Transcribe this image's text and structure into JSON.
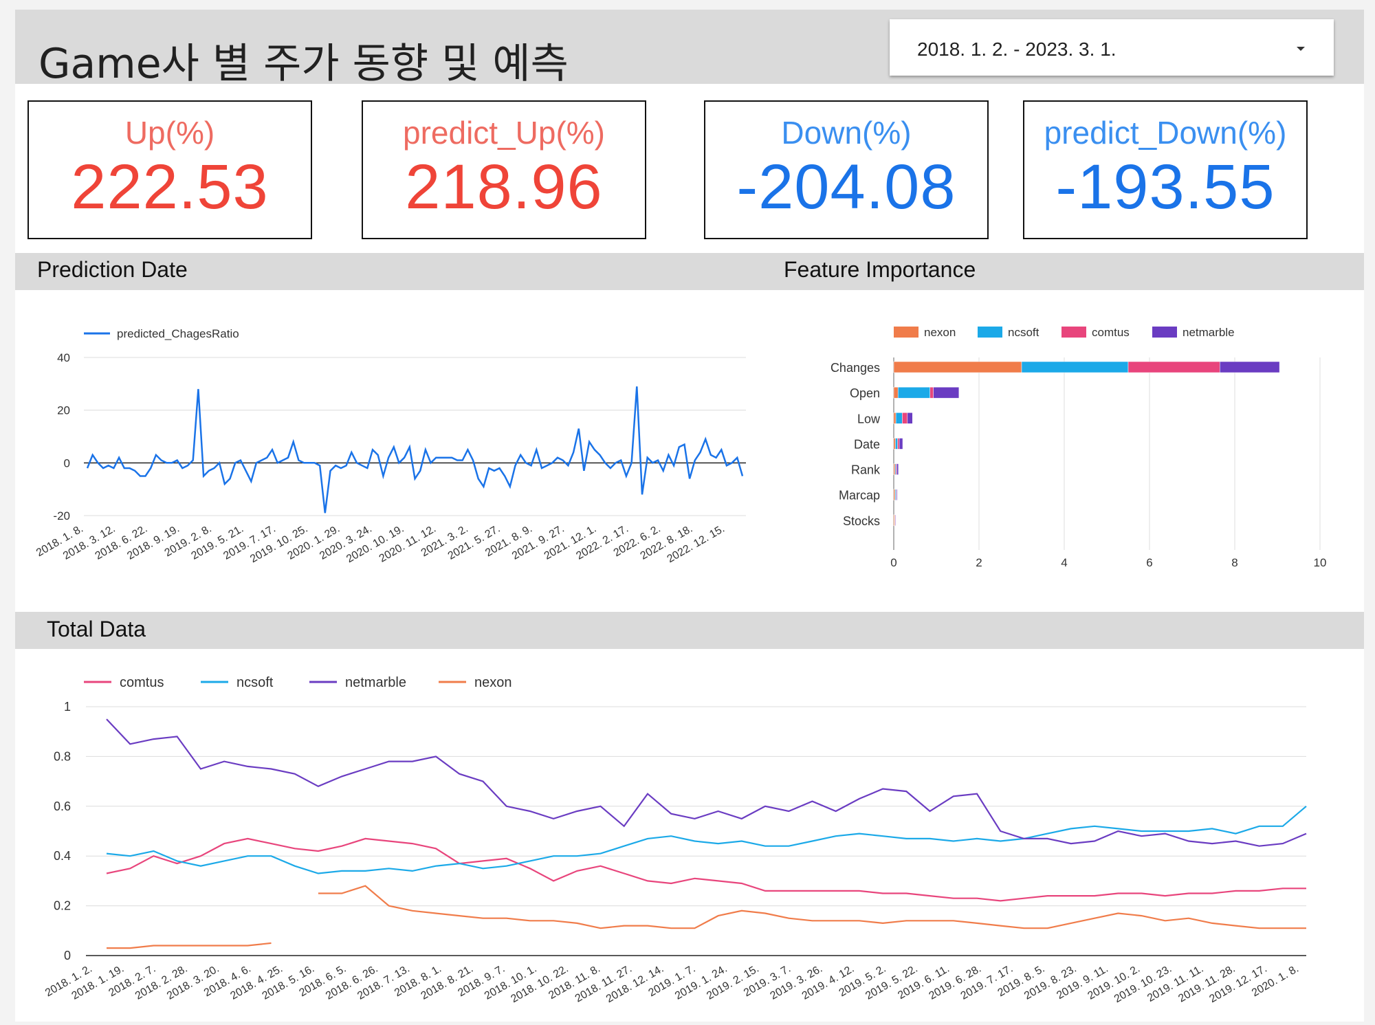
{
  "header": {
    "title": "Game사 별 주가 동향 및 예측",
    "date_range": "2018. 1. 2. - 2023. 3. 1."
  },
  "kpis": [
    {
      "label": "Up(%)",
      "value": "222.53"
    },
    {
      "label": "predict_Up(%)",
      "value": "218.96"
    },
    {
      "label": "Down(%)",
      "value": "-204.08"
    },
    {
      "label": "predict_Down(%)",
      "value": "-193.55"
    }
  ],
  "sections": {
    "prediction": "Prediction Date",
    "feature": "Feature Importance",
    "total": "Total Data"
  },
  "colors": {
    "nexon": "#f07c4a",
    "ncsoft": "#1ba9e8",
    "comtus": "#e8457c",
    "netmarble": "#6a3cc2",
    "predicted": "#1a73e8"
  },
  "chart_data": [
    {
      "type": "line",
      "title": "",
      "legend": [
        "predicted_ChagesRatio"
      ],
      "ylim": [
        -20,
        40
      ],
      "yticks": [
        "40",
        "20",
        "0",
        "-20"
      ],
      "x": [
        "2018. 1. 8.",
        "2018. 3. 12.",
        "2018. 6. 22.",
        "2018. 9. 19.",
        "2019. 2. 8.",
        "2019. 5. 21.",
        "2019. 7. 17.",
        "2019. 10. 25.",
        "2020. 1. 29.",
        "2020. 3. 24.",
        "2020. 10. 19.",
        "2020. 11. 12.",
        "2021. 3. 2.",
        "2021. 5. 27.",
        "2021. 8. 9.",
        "2021. 9. 27.",
        "2021. 12. 1.",
        "2022. 2. 17.",
        "2022. 6. 2.",
        "2022. 8. 18.",
        "2022. 12. 15."
      ],
      "series": [
        {
          "name": "predicted_ChagesRatio",
          "values": [
            -2,
            3,
            0,
            -2,
            -1,
            -2,
            2,
            -2,
            -2,
            -3,
            -5,
            -5,
            -2,
            3,
            1,
            0,
            0,
            1,
            -2,
            -1,
            1,
            28,
            -5,
            -3,
            -2,
            0,
            -8,
            -6,
            0,
            1,
            -3,
            -7,
            0,
            1,
            2,
            5,
            0,
            1,
            2,
            8,
            1,
            0,
            0,
            0,
            -1,
            -19,
            -3,
            -1,
            -2,
            -1,
            4,
            0,
            -1,
            -2,
            5,
            3,
            -5,
            2,
            6,
            0,
            2,
            6,
            -6,
            -3,
            5,
            0,
            2,
            2,
            2,
            2,
            1,
            1,
            5,
            1,
            -6,
            -9,
            -2,
            -3,
            -2,
            -5,
            -9,
            -1,
            3,
            0,
            -1,
            5,
            -2,
            -1,
            0,
            2,
            1,
            -1,
            4,
            13,
            -3,
            8,
            5,
            3,
            0,
            -2,
            0,
            1,
            -5,
            0,
            29,
            -12,
            2,
            0,
            1,
            -3,
            3,
            -1,
            6,
            7,
            -6,
            1,
            4,
            9,
            3,
            2,
            5,
            -1,
            0,
            2,
            -5
          ],
          "color": "#1a73e8"
        }
      ]
    },
    {
      "type": "bar",
      "orientation": "horizontal",
      "stacked": true,
      "title": "",
      "categories": [
        "Changes",
        "Open",
        "Low",
        "Date",
        "Rank",
        "Marcap",
        "Stocks"
      ],
      "xlim": [
        0,
        10
      ],
      "xticks": [
        "0",
        "2",
        "4",
        "6",
        "8",
        "10"
      ],
      "series": [
        {
          "name": "nexon",
          "values": [
            3.0,
            0.1,
            0.05,
            0.04,
            0.03,
            0.03,
            0.02
          ]
        },
        {
          "name": "ncsoft",
          "values": [
            2.5,
            0.75,
            0.15,
            0.05,
            0.02,
            0.02,
            0.01
          ]
        },
        {
          "name": "comtus",
          "values": [
            2.15,
            0.08,
            0.12,
            0.04,
            0.02,
            0.01,
            0.01
          ]
        },
        {
          "name": "netmarble",
          "values": [
            1.4,
            0.6,
            0.12,
            0.08,
            0.04,
            0.02,
            0.01
          ]
        }
      ]
    },
    {
      "type": "line",
      "title": "",
      "legend": [
        "comtus",
        "ncsoft",
        "netmarble",
        "nexon"
      ],
      "ylim": [
        0,
        1
      ],
      "yticks": [
        "1",
        "0.8",
        "0.6",
        "0.4",
        "0.2",
        "0"
      ],
      "x": [
        "2018. 1. 2.",
        "2018. 1. 19.",
        "2018. 2. 7.",
        "2018. 2. 28.",
        "2018. 3. 20.",
        "2018. 4. 6.",
        "2018. 4. 25.",
        "2018. 5. 16.",
        "2018. 6. 5.",
        "2018. 6. 26.",
        "2018. 7. 13.",
        "2018. 8. 1.",
        "2018. 8. 21.",
        "2018. 9. 7.",
        "2018. 10. 1.",
        "2018. 10. 22.",
        "2018. 11. 8.",
        "2018. 11. 27.",
        "2018. 12. 14.",
        "2019. 1. 7.",
        "2019. 1. 24.",
        "2019. 2. 15.",
        "2019. 3. 7.",
        "2019. 3. 26.",
        "2019. 4. 12.",
        "2019. 5. 2.",
        "2019. 5. 22.",
        "2019. 6. 11.",
        "2019. 6. 28.",
        "2019. 7. 17.",
        "2019. 8. 5.",
        "2019. 8. 23.",
        "2019. 9. 11.",
        "2019. 10. 2.",
        "2019. 10. 23.",
        "2019. 11. 11.",
        "2019. 11. 28.",
        "2019. 12. 17.",
        "2020. 1. 8."
      ],
      "series": [
        {
          "name": "comtus",
          "values": [
            0.33,
            0.35,
            0.4,
            0.37,
            0.4,
            0.45,
            0.47,
            0.45,
            0.43,
            0.42,
            0.44,
            0.47,
            0.46,
            0.45,
            0.43,
            0.37,
            0.38,
            0.39,
            0.35,
            0.3,
            0.34,
            0.36,
            0.33,
            0.3,
            0.29,
            0.31,
            0.3,
            0.29,
            0.26,
            0.26,
            0.26,
            0.26,
            0.26,
            0.25,
            0.25,
            0.24,
            0.23,
            0.23,
            0.22,
            0.23,
            0.24,
            0.24,
            0.24,
            0.25,
            0.25,
            0.24,
            0.25,
            0.25,
            0.26,
            0.26,
            0.27,
            0.27
          ]
        },
        {
          "name": "ncsoft",
          "values": [
            0.41,
            0.4,
            0.42,
            0.38,
            0.36,
            0.38,
            0.4,
            0.4,
            0.36,
            0.33,
            0.34,
            0.34,
            0.35,
            0.34,
            0.36,
            0.37,
            0.35,
            0.36,
            0.38,
            0.4,
            0.4,
            0.41,
            0.44,
            0.47,
            0.48,
            0.46,
            0.45,
            0.46,
            0.44,
            0.44,
            0.46,
            0.48,
            0.49,
            0.48,
            0.47,
            0.47,
            0.46,
            0.47,
            0.46,
            0.47,
            0.49,
            0.51,
            0.52,
            0.51,
            0.5,
            0.5,
            0.5,
            0.51,
            0.49,
            0.52,
            0.52,
            0.6
          ]
        },
        {
          "name": "netmarble",
          "values": [
            0.95,
            0.85,
            0.87,
            0.88,
            0.75,
            0.78,
            0.76,
            0.75,
            0.73,
            0.68,
            0.72,
            0.75,
            0.78,
            0.78,
            0.8,
            0.73,
            0.7,
            0.6,
            0.58,
            0.55,
            0.58,
            0.6,
            0.52,
            0.65,
            0.57,
            0.55,
            0.58,
            0.55,
            0.6,
            0.58,
            0.62,
            0.58,
            0.63,
            0.67,
            0.66,
            0.58,
            0.64,
            0.65,
            0.5,
            0.47,
            0.47,
            0.45,
            0.46,
            0.5,
            0.48,
            0.49,
            0.46,
            0.45,
            0.46,
            0.44,
            0.45,
            0.49
          ]
        },
        {
          "name": "nexon",
          "values": [
            0.03,
            0.03,
            0.04,
            0.04,
            0.04,
            0.04,
            0.04,
            0.05,
            null,
            0.25,
            0.25,
            0.28,
            0.2,
            0.18,
            0.17,
            0.16,
            0.15,
            0.15,
            0.14,
            0.14,
            0.13,
            0.11,
            0.12,
            0.12,
            0.11,
            0.11,
            0.16,
            0.18,
            0.17,
            0.15,
            0.14,
            0.14,
            0.14,
            0.13,
            0.14,
            0.14,
            0.14,
            0.13,
            0.12,
            0.11,
            0.11,
            0.13,
            0.15,
            0.17,
            0.16,
            0.14,
            0.15,
            0.13,
            0.12,
            0.11,
            0.11,
            0.11
          ]
        }
      ]
    }
  ]
}
